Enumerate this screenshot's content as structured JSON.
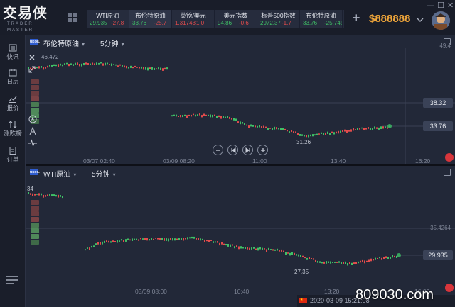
{
  "app": {
    "logo_cn": "交易侠",
    "logo_en": "TRADER MASTER"
  },
  "tickers": [
    {
      "name": "WTI原油",
      "price": "29.935",
      "change": "-27.8",
      "dir": "up"
    },
    {
      "name": "布伦特原油",
      "price": "33.76",
      "change": "-25.7",
      "dir": "up"
    },
    {
      "name": "英镑/美元",
      "price": "1.31743",
      "change": "1.0",
      "dir": "down"
    },
    {
      "name": "美元指数",
      "price": "94.86",
      "change": "-0.6",
      "dir": "up"
    },
    {
      "name": "标普500指数",
      "price": "2972.37",
      "change": "-1.7",
      "dir": "up"
    },
    {
      "name": "布伦特原油",
      "price": "33.76",
      "change": "-25.74%",
      "dir": "up"
    }
  ],
  "account": {
    "balance": "$888888"
  },
  "sidebar": {
    "items": [
      {
        "label": "快讯",
        "icon": "news-icon"
      },
      {
        "label": "日历",
        "icon": "calendar-icon"
      },
      {
        "label": "报价",
        "icon": "quote-icon"
      },
      {
        "label": "涨跌榜",
        "icon": "ranking-icon"
      },
      {
        "label": "订单",
        "icon": "order-icon"
      }
    ]
  },
  "pane1": {
    "symbol_icon": "UKOIL",
    "symbol": "布伦特原油",
    "timeframe": "5分钟",
    "tool_label": "46.472",
    "axis_top": "49.4",
    "price_tag_1": "38.32",
    "price_tag_2": "33.76",
    "low_label": "31.26",
    "x_ticks": [
      "03/07 02:40",
      "03/09 08:20",
      "11:00",
      "13:40",
      "16:20"
    ]
  },
  "pane2": {
    "symbol_icon": "USOIL",
    "symbol": "WTI原油",
    "timeframe": "5分钟",
    "left_label": "34",
    "axis_level": "35.4264",
    "price_tag": "29.935",
    "low_label": "27.35",
    "x_ticks": [
      "03/09 08:00",
      "10:40",
      "13:20",
      "16:00"
    ]
  },
  "status": {
    "datetime": "2020-03-09 15:21:08"
  },
  "watermark": "809030.com",
  "colors": {
    "up": "#3fbf66",
    "down": "#e24c4c",
    "gold": "#f0a63a",
    "background": "#222838"
  }
}
